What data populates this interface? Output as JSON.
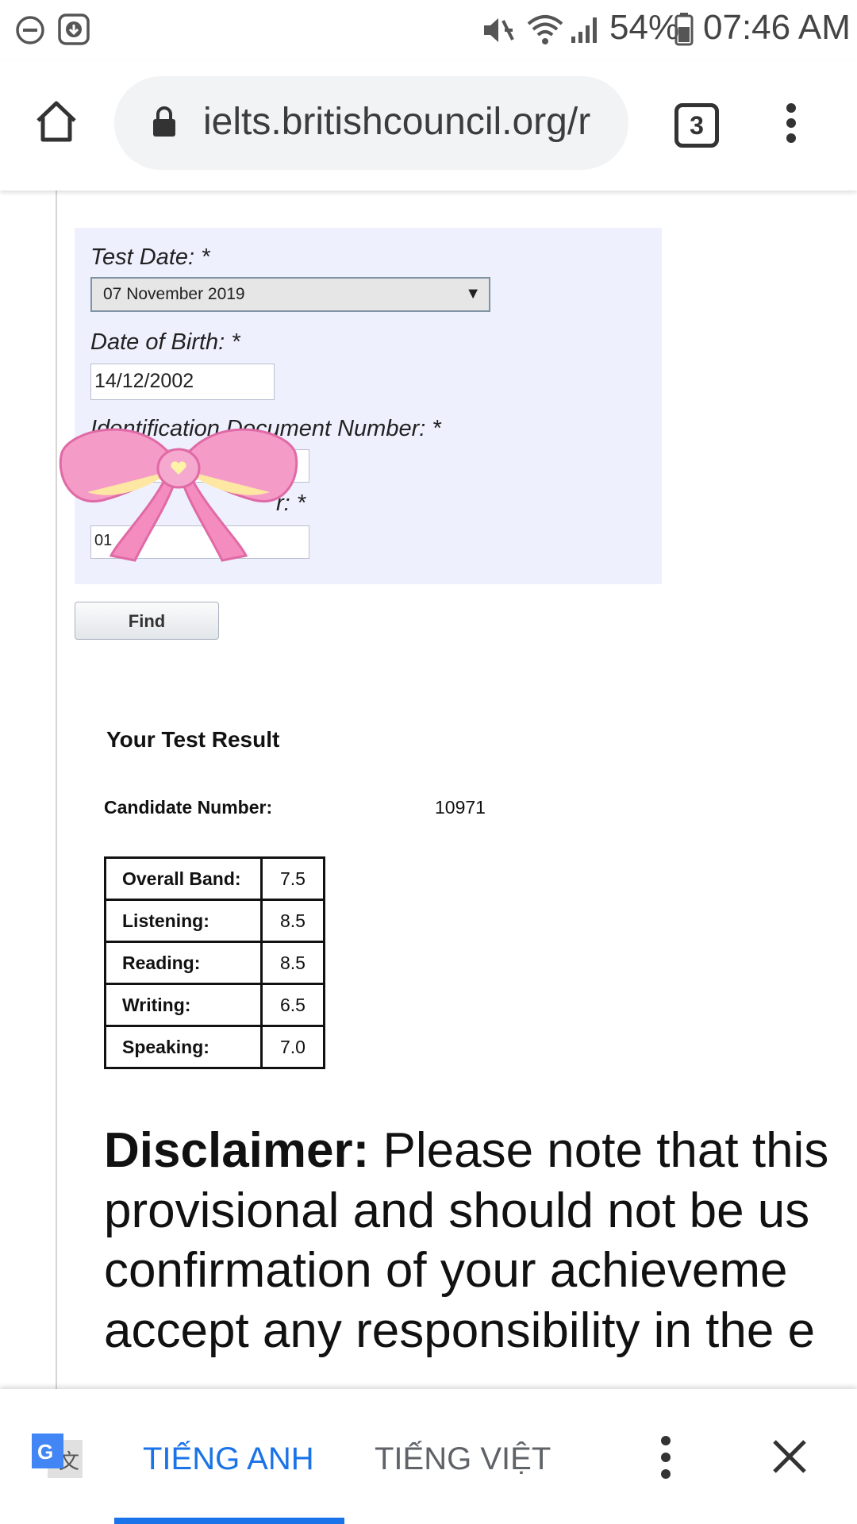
{
  "status_bar": {
    "battery": "54%",
    "time": "07:46 AM",
    "icons": [
      "do-not-disturb-icon",
      "download-icon",
      "mute-icon",
      "wifi-icon",
      "signal-icon",
      "battery-icon"
    ]
  },
  "browser": {
    "url": "ielts.britishcouncil.org/r",
    "tab_count": "3",
    "icons": [
      "home-icon",
      "lock-icon",
      "more-icon"
    ]
  },
  "form": {
    "test_date_label": "Test Date: *",
    "test_date_value": "07 November 2019",
    "dob_label": "Date of Birth: *",
    "dob_value": "14/12/2002",
    "id_label": "Identification Document Number: *",
    "candidate_field_label_partial": "r: *",
    "candidate_field_value_partial": "01",
    "find_button": "Find"
  },
  "result": {
    "heading": "Your Test Result",
    "candidate_label": "Candidate Number:",
    "candidate_value": "10971",
    "scores": [
      {
        "label": "Overall Band:",
        "value": "7.5"
      },
      {
        "label": "Listening:",
        "value": "8.5"
      },
      {
        "label": "Reading:",
        "value": "8.5"
      },
      {
        "label": "Writing:",
        "value": "6.5"
      },
      {
        "label": "Speaking:",
        "value": "7.0"
      }
    ]
  },
  "disclaimer": {
    "bold": "Disclaimer:",
    "line1": " Please note that this",
    "line2": "provisional and should not be us",
    "line3": "confirmation of your achieveme",
    "line4": "accept any responsibility in the e"
  },
  "translate": {
    "source_lang": "TIẾNG ANH",
    "target_lang": "TIẾNG VIỆT",
    "accent": "#1a73e8"
  }
}
